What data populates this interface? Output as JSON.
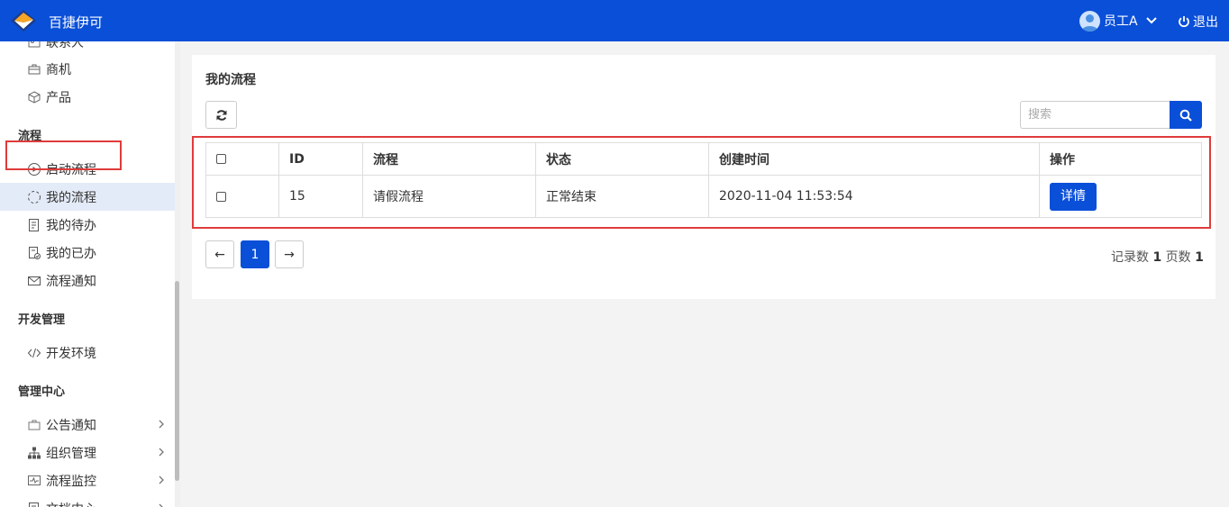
{
  "topbar": {
    "brand": "百捷伊可",
    "user_name": "员工A",
    "logout_label": "退出"
  },
  "sidebar": {
    "items_top": [
      {
        "label": "联系人",
        "icon": "contact-icon"
      },
      {
        "label": "商机",
        "icon": "briefcase-icon"
      },
      {
        "label": "产品",
        "icon": "cube-icon"
      }
    ],
    "section_process": "流程",
    "items_process": [
      {
        "label": "启动流程",
        "icon": "play-circle-icon"
      },
      {
        "label": "我的流程",
        "icon": "loading-circle-icon"
      },
      {
        "label": "我的待办",
        "icon": "todo-doc-icon"
      },
      {
        "label": "我的已办",
        "icon": "done-doc-icon"
      },
      {
        "label": "流程通知",
        "icon": "mail-icon"
      }
    ],
    "section_dev": "开发管理",
    "items_dev": [
      {
        "label": "开发环境",
        "icon": "code-icon"
      }
    ],
    "section_admin": "管理中心",
    "items_admin": [
      {
        "label": "公告通知",
        "icon": "notice-icon"
      },
      {
        "label": "组织管理",
        "icon": "org-tree-icon"
      },
      {
        "label": "流程监控",
        "icon": "monitor-icon"
      },
      {
        "label": "文档中心",
        "icon": "doc-center-icon"
      }
    ]
  },
  "main": {
    "title": "我的流程",
    "search_placeholder": "搜索",
    "table": {
      "headers": [
        "ID",
        "流程",
        "状态",
        "创建时间",
        "操作"
      ],
      "rows": [
        {
          "id": "15",
          "process": "请假流程",
          "status": "正常结束",
          "created": "2020-11-04 11:53:54",
          "action": "详情"
        }
      ]
    },
    "pager": {
      "prev": "←",
      "current": "1",
      "next": "→",
      "records_label": "记录数",
      "records": "1",
      "pages_label": "页数",
      "pages": "1"
    }
  },
  "colors": {
    "primary": "#0a4fd8",
    "success": "#4cae4c",
    "highlight": "#e03b3b",
    "active_bg": "#e4ebf8"
  }
}
